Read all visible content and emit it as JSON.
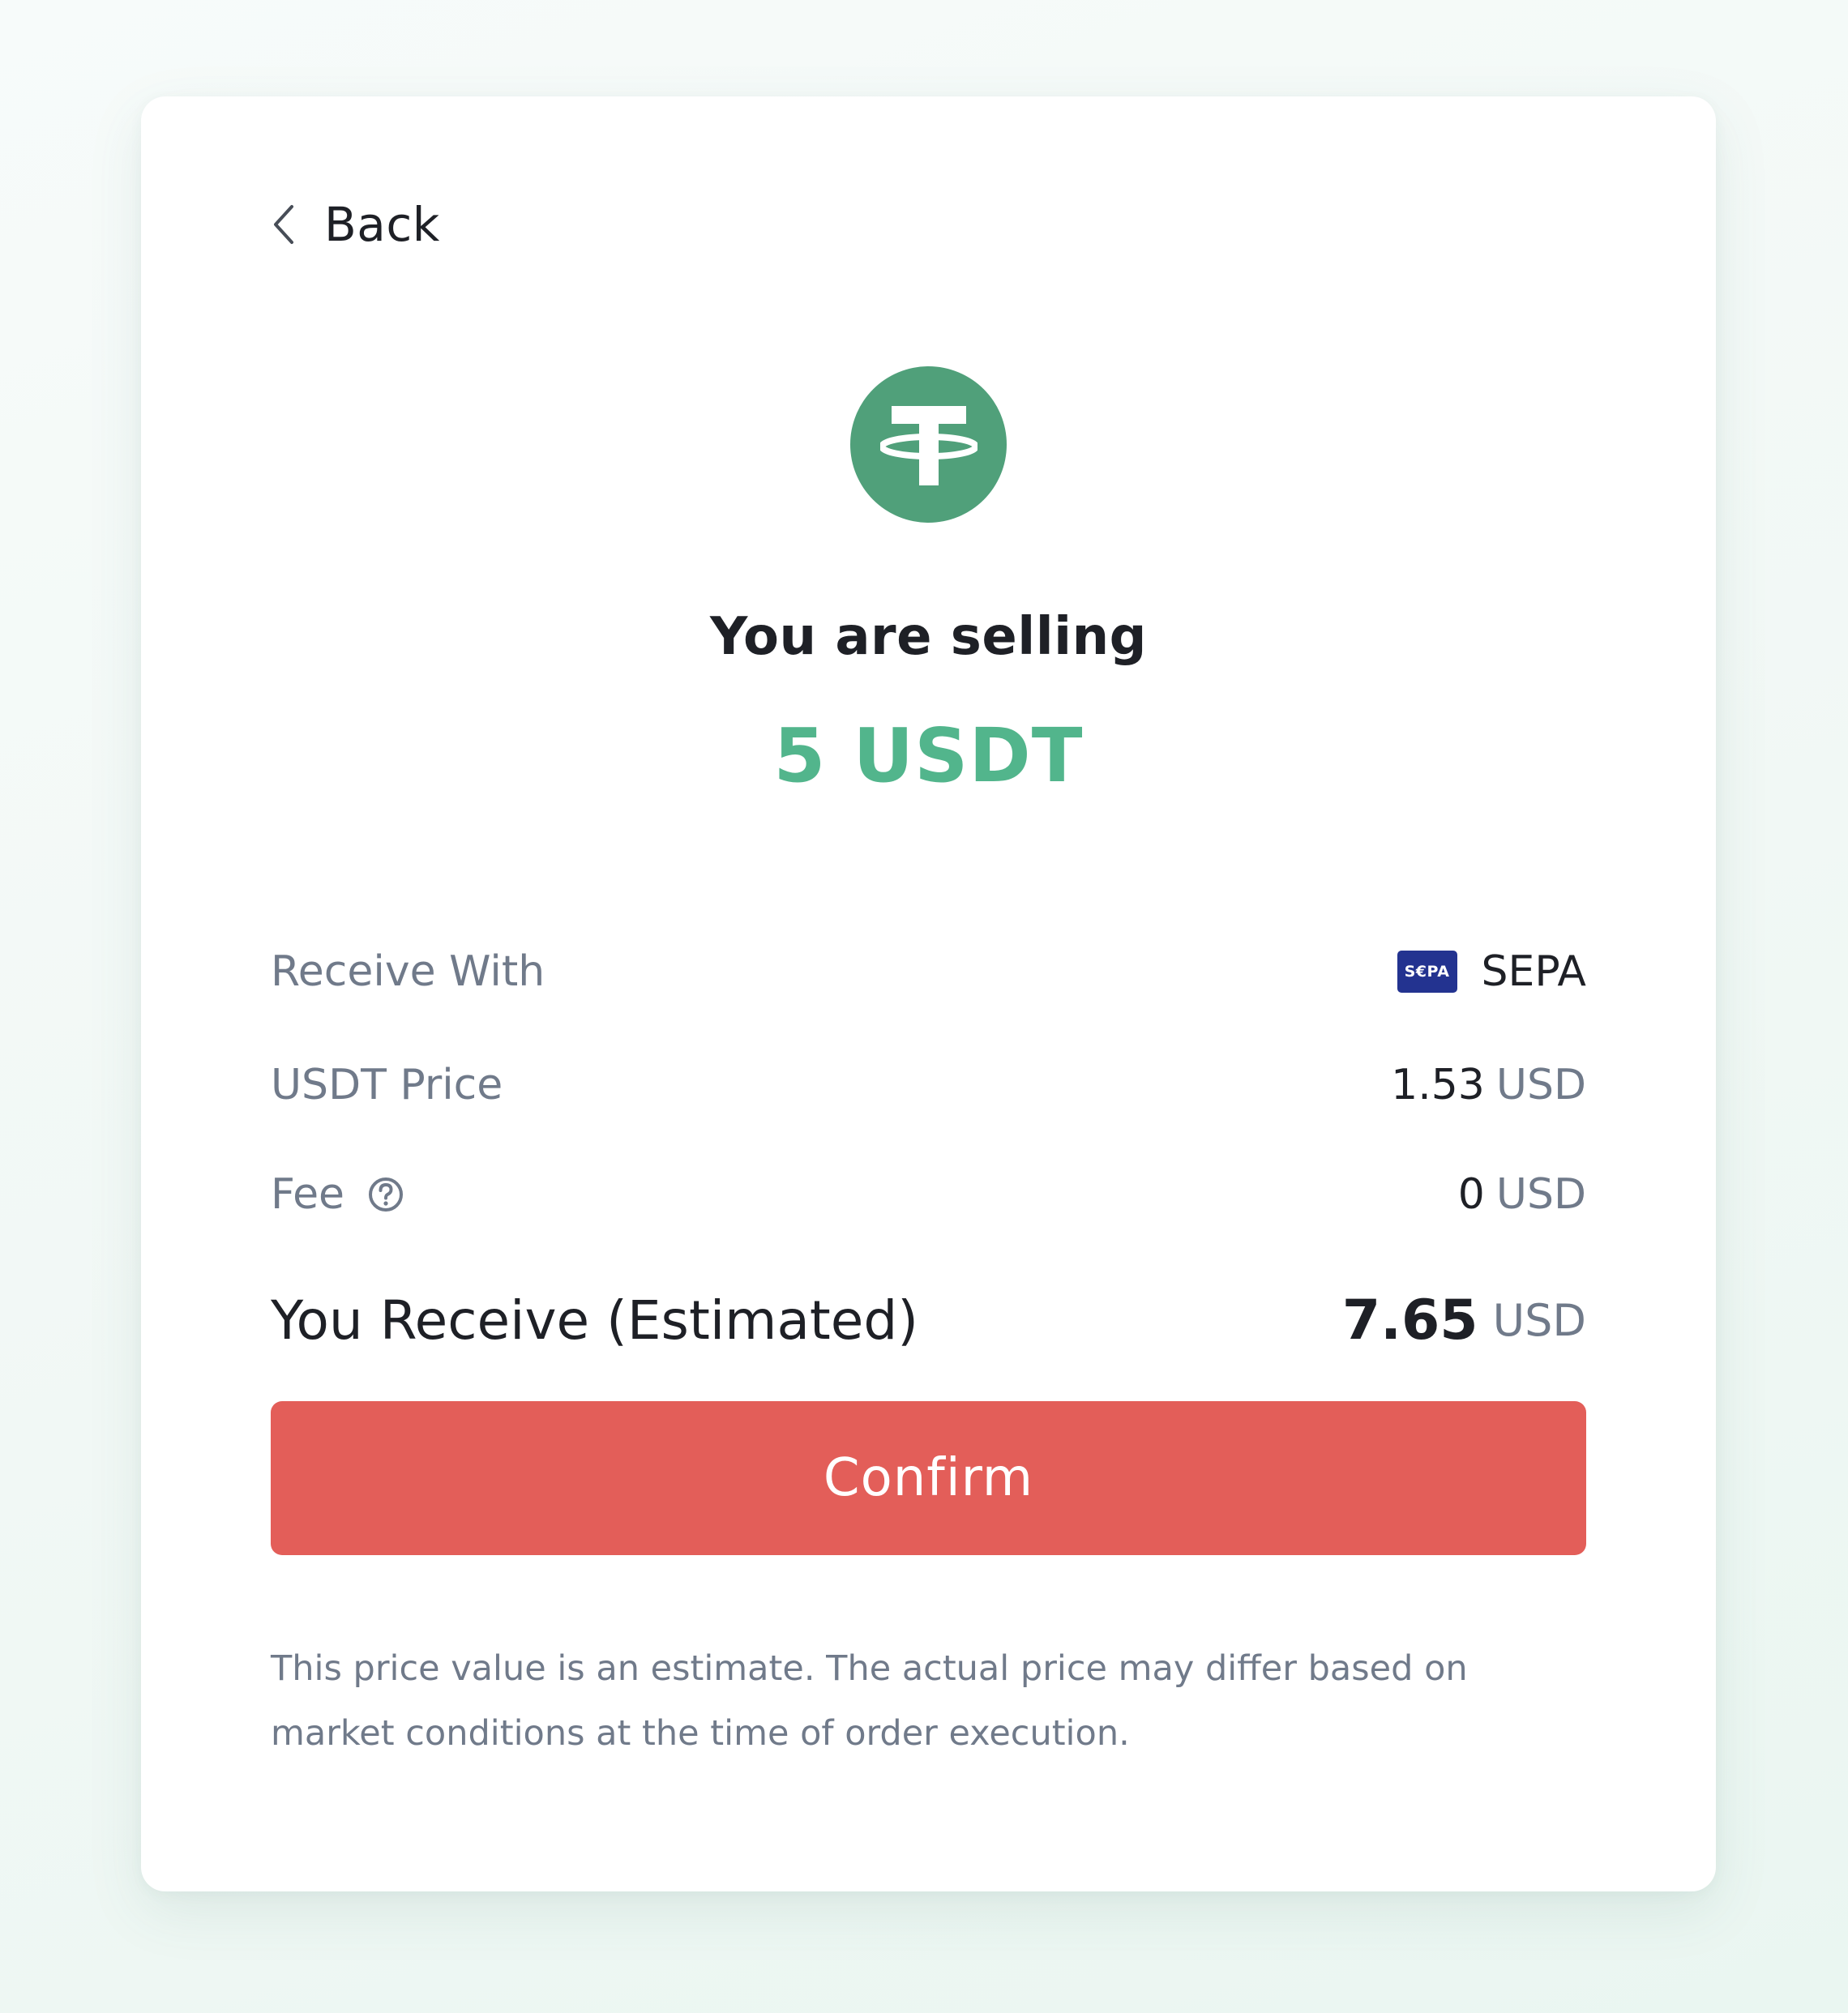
{
  "back": {
    "label": "Back",
    "icon": "chevron-left-icon"
  },
  "asset": {
    "icon": "tether-logo",
    "brand_color": "#50a07a"
  },
  "selling": {
    "title": "You are selling",
    "amount": "5 USDT",
    "amount_color": "#52b58c"
  },
  "details": {
    "receive_with": {
      "label": "Receive With",
      "method_badge": "S€PA",
      "method": "SEPA"
    },
    "price": {
      "label": "USDT Price",
      "value": "1.53",
      "unit": "USD"
    },
    "fee": {
      "label": "Fee",
      "value": "0",
      "unit": "USD",
      "help_icon": "question-circle-icon"
    },
    "receive": {
      "label": "You Receive (Estimated)",
      "value": "7.65",
      "unit": "USD"
    }
  },
  "confirm": {
    "label": "Confirm",
    "color": "#e35e59"
  },
  "disclaimer": "This price value is an estimate. The actual price may differ based on market conditions at the time of order execution."
}
